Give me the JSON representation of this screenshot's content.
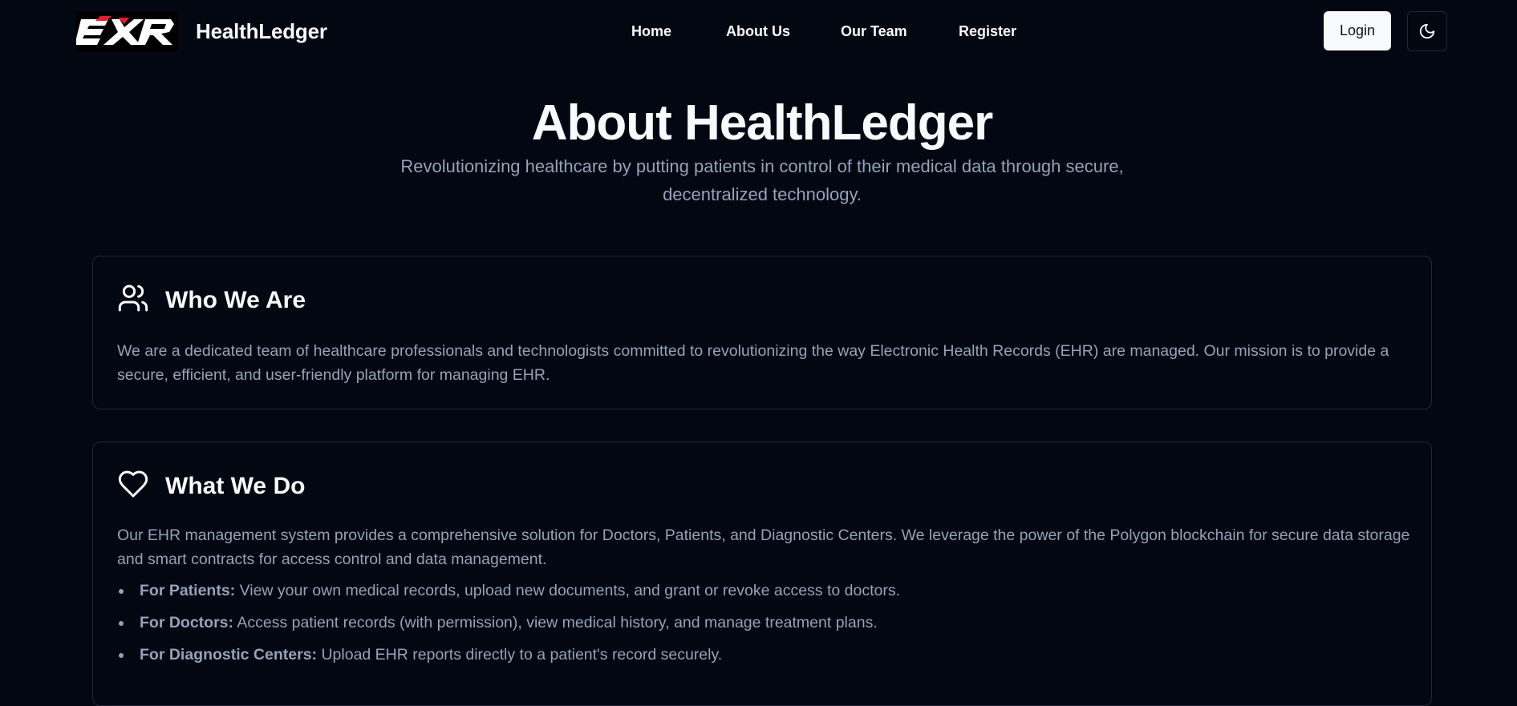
{
  "header": {
    "logo_text": "EHR",
    "brand": "HealthLedger",
    "nav": [
      {
        "label": "Home"
      },
      {
        "label": "About Us"
      },
      {
        "label": "Our Team"
      },
      {
        "label": "Register"
      }
    ],
    "login_label": "Login",
    "theme_icon": "moon-icon"
  },
  "hero": {
    "title": "About HealthLedger",
    "subtitle": "Revolutionizing healthcare by putting patients in control of their medical data through secure, decentralized technology."
  },
  "sections": [
    {
      "icon": "users-icon",
      "title": "Who We Are",
      "text": "We are a dedicated team of healthcare professionals and technologists committed to revolutionizing the way Electronic Health Records (EHR) are managed. Our mission is to provide a secure, efficient, and user-friendly platform for managing EHR."
    },
    {
      "icon": "heart-icon",
      "title": "What We Do",
      "text": "Our EHR management system provides a comprehensive solution for Doctors, Patients, and Diagnostic Centers. We leverage the power of the Polygon blockchain for secure data storage and smart contracts for access control and data management.",
      "bullets": [
        {
          "label": "For Patients:",
          "text": " View your own medical records, upload new documents, and grant or revoke access to doctors."
        },
        {
          "label": "For Doctors:",
          "text": " Access patient records (with permission), view medical history, and manage treatment plans."
        },
        {
          "label": "For Diagnostic Centers:",
          "text": " Upload EHR reports directly to a patient's record securely."
        }
      ]
    }
  ],
  "colors": {
    "background": "#030712",
    "text": "#f8fafc",
    "muted": "#94a3b8",
    "border": "#1f2937"
  }
}
